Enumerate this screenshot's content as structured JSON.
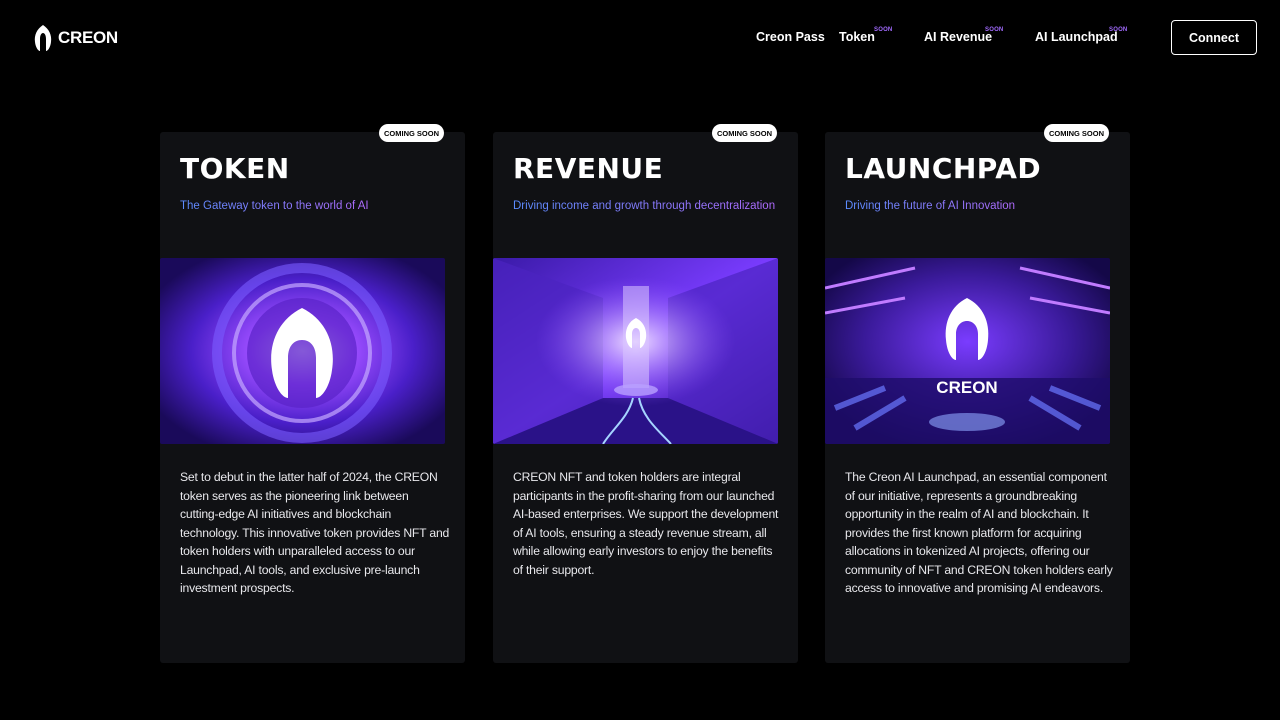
{
  "brand": {
    "name": "CREON"
  },
  "nav": {
    "items": [
      {
        "label": "Creon Pass",
        "soon": ""
      },
      {
        "label": "Token",
        "soon": "SOON"
      },
      {
        "label": "AI Revenue",
        "soon": "SOON"
      },
      {
        "label": "AI Launchpad",
        "soon": "SOON"
      }
    ],
    "connect_label": "Connect"
  },
  "cards": [
    {
      "badge": "COMING SOON",
      "title": "TOKEN",
      "subtitle": "The Gateway token to the world of AI",
      "body": "Set to debut in the latter half of 2024, the CREON token serves as the pioneering link between cutting-edge AI initiatives and blockchain technology. This innovative token provides NFT and token holders with unparalleled access to our Launchpad, AI tools, and exclusive pre-launch investment prospects."
    },
    {
      "badge": "COMING SOON",
      "title": "REVENUE",
      "subtitle": "Driving income and growth through decentralization",
      "body": "CREON NFT and token holders are integral participants in the profit-sharing from our launched AI-based enterprises. We support the development of AI tools, ensuring a steady revenue stream, all while allowing early investors to enjoy the benefits of their support."
    },
    {
      "badge": "COMING SOON",
      "title": "LAUNCHPAD",
      "subtitle": "Driving the future of AI Innovation",
      "body": "The Creon AI Launchpad, an essential component of our initiative, represents a groundbreaking opportunity in the realm of AI and blockchain. It provides the first known platform for acquiring allocations in tokenized AI projects, offering our community of NFT and CREON token holders early access to innovative and promising AI endeavors.",
      "image_text": "CREON"
    }
  ],
  "colors": {
    "accent_purple": "#a26bff",
    "subtitle_start": "#5b8cff",
    "subtitle_end": "#b06bff",
    "card_bg": "#101114"
  }
}
